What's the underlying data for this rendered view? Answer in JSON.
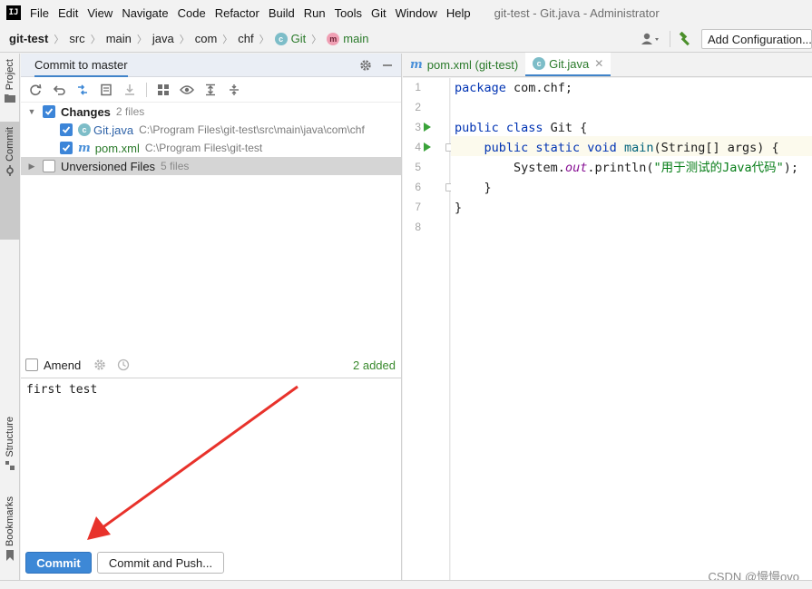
{
  "menubar": {
    "logo_text": "IJ",
    "items": [
      "File",
      "Edit",
      "View",
      "Navigate",
      "Code",
      "Refactor",
      "Build",
      "Run",
      "Tools",
      "Git",
      "Window",
      "Help"
    ],
    "window_title": "git-test - Git.java - Administrator"
  },
  "navbar": {
    "breadcrumbs": [
      "git-test",
      "src",
      "main",
      "java",
      "com",
      "chf",
      "Git",
      "main"
    ],
    "class_badge": "c",
    "method_badge": "m",
    "add_configuration_label": "Add Configuration..."
  },
  "left_stripe": {
    "project_label": "Project",
    "commit_label": "Commit",
    "structure_label": "Structure",
    "bookmarks_label": "Bookmarks"
  },
  "commit_panel": {
    "title": "Commit to master",
    "changes": {
      "label": "Changes",
      "count": "2 files",
      "files": [
        {
          "name": "Git.java",
          "path": "C:\\Program Files\\git-test\\src\\main\\java\\com\\chf",
          "icon": "c"
        },
        {
          "name": "pom.xml",
          "path": "C:\\Program Files\\git-test",
          "icon": "m"
        }
      ]
    },
    "unversioned": {
      "label": "Unversioned Files",
      "count": "5 files"
    },
    "amend_label": "Amend",
    "added_count": "2 added",
    "message": "first test",
    "commit_button": "Commit",
    "commit_push_button": "Commit and Push..."
  },
  "editor": {
    "tabs": [
      {
        "label": "pom.xml (git-test)",
        "icon": "m",
        "active": false
      },
      {
        "label": "Git.java",
        "icon": "c",
        "active": true
      }
    ],
    "line_numbers": [
      "1",
      "2",
      "3",
      "4",
      "5",
      "6",
      "7",
      "8"
    ],
    "code": {
      "line1_kw": "package",
      "line1_rest": " com.chf;",
      "line3_kw": "public class",
      "line3_rest": " Git {",
      "line4_indent": "    ",
      "line4_kw": "public static void",
      "line4_fn": "main",
      "line4_rest": "(String[] args) {",
      "line5_indent": "        ",
      "line5_obj": "System.",
      "line5_field": "out",
      "line5_call": ".println(",
      "line5_str": "\"用于测试的Java代码\"",
      "line5_end": ");",
      "line6": "    }",
      "line7": "}"
    }
  },
  "watermark": "CSDN @慢慢ovo",
  "colors": {
    "accent": "#3d88d6",
    "arrow": "#e8322b",
    "added_green": "#3a8a2e"
  }
}
